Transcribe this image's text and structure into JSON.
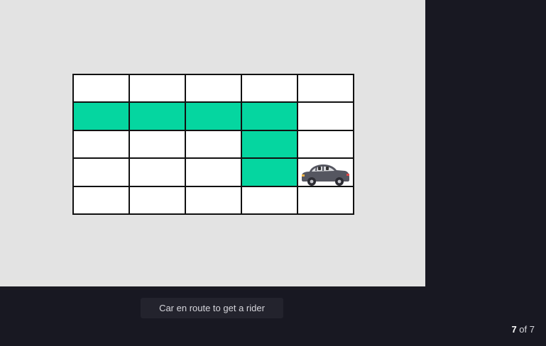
{
  "grid": {
    "rows": 5,
    "cols": 5,
    "highlight_color": "#05d6a0",
    "path_cells": [
      [
        1,
        0
      ],
      [
        1,
        1
      ],
      [
        1,
        2
      ],
      [
        1,
        3
      ],
      [
        2,
        3
      ],
      [
        3,
        3
      ]
    ],
    "car_cell": [
      3,
      4
    ],
    "car_icon": "car-icon"
  },
  "caption": {
    "text": "Car en route to get a rider"
  },
  "pager": {
    "current": "7",
    "separator": " of ",
    "total": "7"
  }
}
